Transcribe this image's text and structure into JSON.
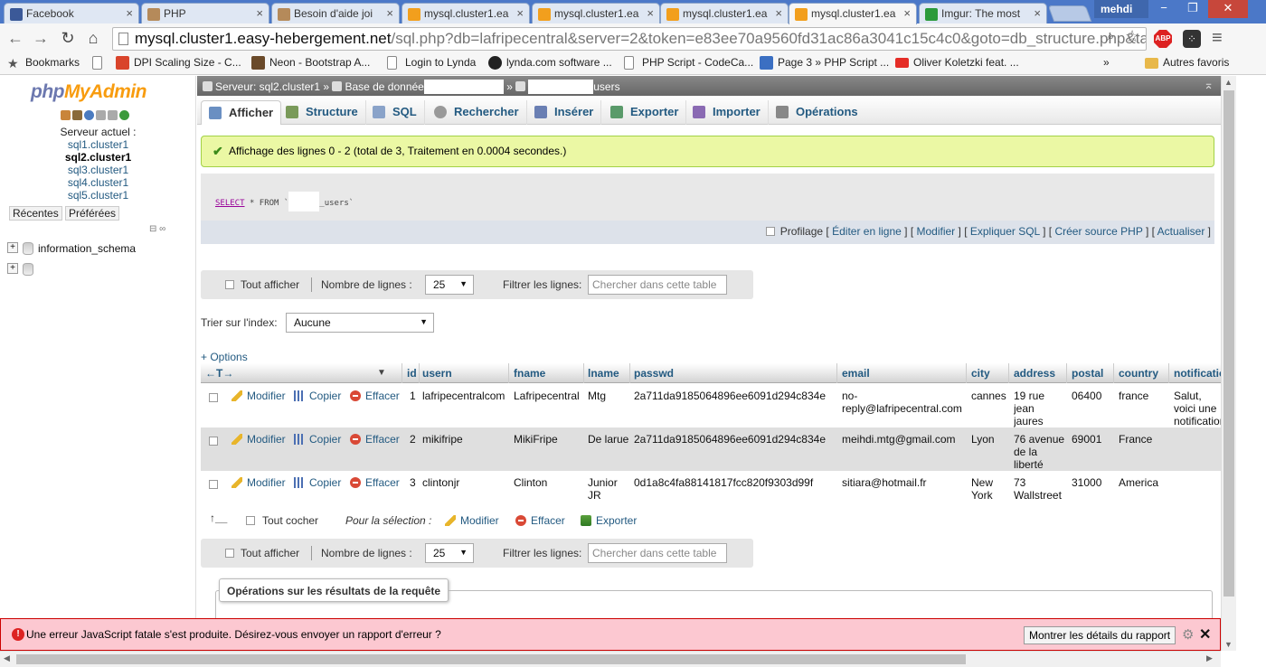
{
  "browser": {
    "tabs": [
      {
        "title": "Facebook",
        "color": "#3b5998"
      },
      {
        "title": "PHP",
        "color": "#b58a5a"
      },
      {
        "title": "Besoin d'aide joi",
        "color": "#b58a5a"
      },
      {
        "title": "mysql.cluster1.ea",
        "color": "#f29f1d"
      },
      {
        "title": "mysql.cluster1.ea",
        "color": "#f29f1d"
      },
      {
        "title": "mysql.cluster1.ea",
        "color": "#f29f1d"
      },
      {
        "title": "mysql.cluster1.ea",
        "color": "#f29f1d"
      },
      {
        "title": "Imgur: The most",
        "color": "#2b9a3b"
      }
    ],
    "user": "mehdi",
    "window_buttons": {
      "minimize": "−",
      "maximize": "❐",
      "close": "✕"
    },
    "url_host": "mysql.cluster1.easy-hebergement.net",
    "url_path": "/sql.php?db=lafripecentral&server=2&token=e83ee70a9560fd31ac86a3041c15c4c0&goto=db_structure.php&tabl",
    "abp": "ABP",
    "bookmarks": [
      {
        "label": "Bookmarks",
        "color": "#777"
      },
      {
        "label": "",
        "color": "#ccc"
      },
      {
        "label": "DPI Scaling Size - C...",
        "color": "#d9442b"
      },
      {
        "label": "Neon - Bootstrap A...",
        "color": "#6a4a2a"
      },
      {
        "label": "Login to Lynda",
        "color": "#ccc"
      },
      {
        "label": "lynda.com software ...",
        "color": "#222"
      },
      {
        "label": "PHP Script - CodeCa...",
        "color": "#ccc"
      },
      {
        "label": "Page 3 » PHP Script ...",
        "color": "#3b6fc2"
      },
      {
        "label": "Oliver Koletzki feat. ...",
        "color": "#e52d27"
      },
      {
        "label": "»",
        "color": "transparent"
      },
      {
        "label": "Autres favoris",
        "color": "#e8b84a"
      }
    ]
  },
  "left": {
    "logo_php": "php",
    "logo_mya": "MyAdmin",
    "server_title": "Serveur actuel :",
    "servers": [
      "sql1.cluster1",
      "sql2.cluster1",
      "sql3.cluster1",
      "sql4.cluster1",
      "sql5.cluster1"
    ],
    "current_server_index": 1,
    "recent_tab": "Récentes",
    "favorites_tab": "Préférées",
    "databases": [
      "information_schema",
      ""
    ]
  },
  "right": {
    "breadcrumb": {
      "server": "Serveur: sql2.cluster1",
      "sep": "»",
      "database": "Base de donnée",
      "table": "users"
    },
    "menu": [
      "Afficher",
      "Structure",
      "SQL",
      "Rechercher",
      "Insérer",
      "Exporter",
      "Importer",
      "Opérations"
    ],
    "success": "Affichage des lignes 0 - 2 (total de 3, Traitement en 0.0004 secondes.)",
    "sql": {
      "select": "SELECT",
      "rest": "* FROM `",
      "table_suffix": "_users`"
    },
    "sql_tools": {
      "profiling": "Profilage",
      "links": [
        "Éditer en ligne",
        "Modifier",
        "Expliquer SQL",
        "Créer source PHP",
        "Actualiser"
      ]
    },
    "nav": {
      "show_all": "Tout afficher",
      "rows_label": "Nombre de lignes :",
      "rows_value": "25",
      "filter_label": "Filtrer les lignes:",
      "filter_placeholder": "Chercher dans cette table"
    },
    "sort_label": "Trier sur l'index:",
    "sort_value": "Aucune",
    "options_link": "+ Options",
    "table": {
      "header_arrows": "←T→",
      "columns": [
        "id",
        "usern",
        "fname",
        "lname",
        "passwd",
        "email",
        "city",
        "address",
        "postal",
        "country",
        "notification"
      ],
      "actions": {
        "edit": "Modifier",
        "copy": "Copier",
        "delete": "Effacer"
      },
      "rows": [
        [
          "1",
          "lafripecentralcom",
          "Lafripecentral",
          "Mtg",
          "2a711da9185064896ee6091d294c834e",
          "no-reply@lafripecentral.com",
          "cannes",
          "19 rue jean jaures",
          "06400",
          "france",
          "Salut, voici une notification"
        ],
        [
          "2",
          "mikifripe",
          "MikiFripe",
          "De larue",
          "2a711da9185064896ee6091d294c834e",
          "meihdi.mtg@gmail.com",
          "Lyon",
          "76 avenue de la liberté",
          "69001",
          "France",
          ""
        ],
        [
          "3",
          "clintonjr",
          "Clinton",
          "Junior JR",
          "0d1a8c4fa88141817fcc820f9303d99f",
          "sitiara@hotmail.fr",
          "New York",
          "73 Wallstreet",
          "31000",
          "America",
          ""
        ]
      ]
    },
    "bulk": {
      "arrow": "↑__",
      "check_all": "Tout cocher",
      "with_selected": "Pour la sélection :",
      "edit": "Modifier",
      "delete": "Effacer",
      "export": "Exporter"
    },
    "ops_legend": "Opérations sur les résultats de la requête"
  },
  "error": {
    "message": "Une erreur JavaScript fatale s'est produite. Désirez-vous envoyer un rapport d'erreur ?",
    "details_button": "Montrer les détails du rapport",
    "close": "✕"
  }
}
